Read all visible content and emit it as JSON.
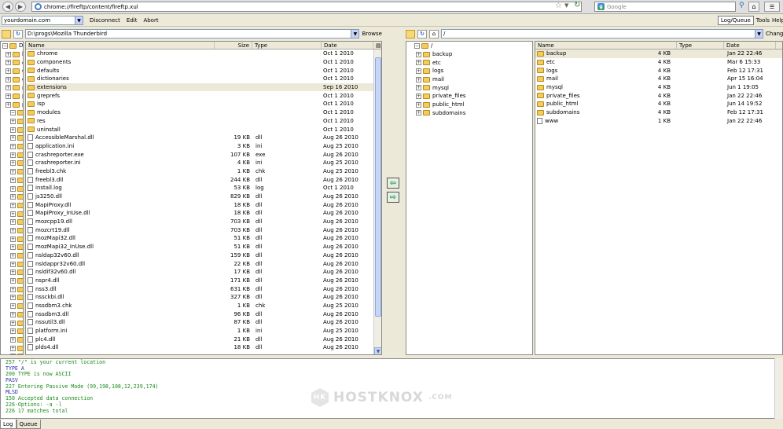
{
  "browser": {
    "url": "chrome://fireftp/content/fireftp.xul",
    "search_placeholder": "Google",
    "search_engine_icon": "g"
  },
  "toolbar": {
    "account": "yourdomain.com",
    "disconnect": "Disconnect",
    "edit": "Edit",
    "abort": "Abort",
    "log_queue": "Log/Queue",
    "tools": "Tools",
    "help": "Help"
  },
  "local": {
    "path": "D:\\progs\\Mozilla Thunderbird",
    "browse": "Browse",
    "tree_root": "D:\\",
    "tree": [
      "bi",
      "c",
      "gi",
      "gi",
      "m",
      "pl",
      "pr",
      "",
      "",
      "",
      "",
      "",
      "",
      "",
      "",
      "",
      "",
      "",
      "",
      "",
      "",
      "",
      "",
      "",
      "",
      "",
      "",
      "",
      "",
      "",
      "",
      "",
      "",
      "",
      "",
      "",
      "",
      "",
      "",
      "",
      "",
      "",
      "S",
      "to"
    ],
    "columns": {
      "name": "Name",
      "size": "Size",
      "type": "Type",
      "date": "Date"
    },
    "files": [
      {
        "name": "chrome",
        "size": "",
        "type": "",
        "date": "Oct 1 2010",
        "kind": "folder"
      },
      {
        "name": "components",
        "size": "",
        "type": "",
        "date": "Oct 1 2010",
        "kind": "folder"
      },
      {
        "name": "defaults",
        "size": "",
        "type": "",
        "date": "Oct 1 2010",
        "kind": "folder"
      },
      {
        "name": "dictionaries",
        "size": "",
        "type": "",
        "date": "Oct 1 2010",
        "kind": "folder"
      },
      {
        "name": "extensions",
        "size": "",
        "type": "",
        "date": "Sep 16 2010",
        "kind": "folder",
        "sel": true
      },
      {
        "name": "greprefs",
        "size": "",
        "type": "",
        "date": "Oct 1 2010",
        "kind": "folder"
      },
      {
        "name": "isp",
        "size": "",
        "type": "",
        "date": "Oct 1 2010",
        "kind": "folder"
      },
      {
        "name": "modules",
        "size": "",
        "type": "",
        "date": "Oct 1 2010",
        "kind": "folder"
      },
      {
        "name": "res",
        "size": "",
        "type": "",
        "date": "Oct 1 2010",
        "kind": "folder"
      },
      {
        "name": "uninstall",
        "size": "",
        "type": "",
        "date": "Oct 1 2010",
        "kind": "folder"
      },
      {
        "name": "AccessibleMarshal.dll",
        "size": "19 KB",
        "type": "dll",
        "date": "Aug 26 2010",
        "kind": "file"
      },
      {
        "name": "application.ini",
        "size": "3 KB",
        "type": "ini",
        "date": "Aug 25 2010",
        "kind": "file"
      },
      {
        "name": "crashreporter.exe",
        "size": "107 KB",
        "type": "exe",
        "date": "Aug 26 2010",
        "kind": "file"
      },
      {
        "name": "crashreporter.ini",
        "size": "4 KB",
        "type": "ini",
        "date": "Aug 25 2010",
        "kind": "file"
      },
      {
        "name": "freebl3.chk",
        "size": "1 KB",
        "type": "chk",
        "date": "Aug 25 2010",
        "kind": "file"
      },
      {
        "name": "freebl3.dll",
        "size": "244 KB",
        "type": "dll",
        "date": "Aug 26 2010",
        "kind": "file"
      },
      {
        "name": "install.log",
        "size": "53 KB",
        "type": "log",
        "date": "Oct 1 2010",
        "kind": "file"
      },
      {
        "name": "js3250.dll",
        "size": "829 KB",
        "type": "dll",
        "date": "Aug 26 2010",
        "kind": "file"
      },
      {
        "name": "MapiProxy.dll",
        "size": "18 KB",
        "type": "dll",
        "date": "Aug 26 2010",
        "kind": "file"
      },
      {
        "name": "MapiProxy_InUse.dll",
        "size": "18 KB",
        "type": "dll",
        "date": "Aug 26 2010",
        "kind": "file"
      },
      {
        "name": "mozcpp19.dll",
        "size": "703 KB",
        "type": "dll",
        "date": "Aug 26 2010",
        "kind": "file"
      },
      {
        "name": "mozcrt19.dll",
        "size": "703 KB",
        "type": "dll",
        "date": "Aug 26 2010",
        "kind": "file"
      },
      {
        "name": "mozMapi32.dll",
        "size": "51 KB",
        "type": "dll",
        "date": "Aug 26 2010",
        "kind": "file"
      },
      {
        "name": "mozMapi32_InUse.dll",
        "size": "51 KB",
        "type": "dll",
        "date": "Aug 26 2010",
        "kind": "file"
      },
      {
        "name": "nsldap32v60.dll",
        "size": "159 KB",
        "type": "dll",
        "date": "Aug 26 2010",
        "kind": "file"
      },
      {
        "name": "nsldappr32v60.dll",
        "size": "22 KB",
        "type": "dll",
        "date": "Aug 26 2010",
        "kind": "file"
      },
      {
        "name": "nsldif32v60.dll",
        "size": "17 KB",
        "type": "dll",
        "date": "Aug 26 2010",
        "kind": "file"
      },
      {
        "name": "nspr4.dll",
        "size": "171 KB",
        "type": "dll",
        "date": "Aug 26 2010",
        "kind": "file"
      },
      {
        "name": "nss3.dll",
        "size": "631 KB",
        "type": "dll",
        "date": "Aug 26 2010",
        "kind": "file"
      },
      {
        "name": "nssckbi.dll",
        "size": "327 KB",
        "type": "dll",
        "date": "Aug 26 2010",
        "kind": "file"
      },
      {
        "name": "nssdbm3.chk",
        "size": "1 KB",
        "type": "chk",
        "date": "Aug 25 2010",
        "kind": "file"
      },
      {
        "name": "nssdbm3.dll",
        "size": "96 KB",
        "type": "dll",
        "date": "Aug 26 2010",
        "kind": "file"
      },
      {
        "name": "nssutil3.dll",
        "size": "87 KB",
        "type": "dll",
        "date": "Aug 26 2010",
        "kind": "file"
      },
      {
        "name": "platform.ini",
        "size": "1 KB",
        "type": "ini",
        "date": "Aug 25 2010",
        "kind": "file"
      },
      {
        "name": "plc4.dll",
        "size": "21 KB",
        "type": "dll",
        "date": "Aug 26 2010",
        "kind": "file"
      },
      {
        "name": "plds4.dll",
        "size": "18 KB",
        "type": "dll",
        "date": "Aug 26 2010",
        "kind": "file"
      }
    ]
  },
  "remote": {
    "path": "/",
    "change": "Change",
    "tree_root": "/",
    "tree": [
      "backup",
      "etc",
      "logs",
      "mail",
      "mysql",
      "private_files",
      "public_html",
      "subdomains"
    ],
    "columns": {
      "name": "Name",
      "size": "Size",
      "type": "Type",
      "date": "Date"
    },
    "files": [
      {
        "name": "backup",
        "size": "4 KB",
        "type": "",
        "date": "Jan 22 22:46",
        "kind": "folder",
        "sel": true
      },
      {
        "name": "etc",
        "size": "4 KB",
        "type": "",
        "date": "Mar 6 15:33",
        "kind": "folder"
      },
      {
        "name": "logs",
        "size": "4 KB",
        "type": "",
        "date": "Feb 12 17:31",
        "kind": "folder"
      },
      {
        "name": "mail",
        "size": "4 KB",
        "type": "",
        "date": "Apr 15 16:04",
        "kind": "folder"
      },
      {
        "name": "mysql",
        "size": "4 KB",
        "type": "",
        "date": "Jun 1 19:05",
        "kind": "folder"
      },
      {
        "name": "private_files",
        "size": "4 KB",
        "type": "",
        "date": "Jan 22 22:46",
        "kind": "folder"
      },
      {
        "name": "public_html",
        "size": "4 KB",
        "type": "",
        "date": "Jun 14 19:52",
        "kind": "folder"
      },
      {
        "name": "subdomains",
        "size": "4 KB",
        "type": "",
        "date": "Feb 12 17:31",
        "kind": "folder"
      },
      {
        "name": "www",
        "size": "1 KB",
        "type": "",
        "date": "Jan 22 22:46",
        "kind": "file"
      }
    ]
  },
  "log": [
    {
      "text": "257 \"/\" is your current location",
      "color": "#1a8a1a"
    },
    {
      "text": "    TYPE A",
      "color": "#2a2ab0"
    },
    {
      "text": "200 TYPE is now ASCII",
      "color": "#1a8a1a"
    },
    {
      "text": "    PASV",
      "color": "#2a2ab0"
    },
    {
      "text": "227 Entering Passive Mode (99,198,108,12,239,174)",
      "color": "#1a8a1a"
    },
    {
      "text": "    MLSD",
      "color": "#2a2ab0"
    },
    {
      "text": "150 Accepted data connection",
      "color": "#1a8a1a"
    },
    {
      "text": "226-Options: -a -l",
      "color": "#1a8a1a"
    },
    {
      "text": "226 17 matches total",
      "color": "#1a8a1a"
    }
  ],
  "tabs": {
    "log": "Log",
    "queue": "Queue"
  },
  "watermark": {
    "brand": "HOSTKNOX",
    "suffix": ".COM",
    "mark": "HK"
  }
}
